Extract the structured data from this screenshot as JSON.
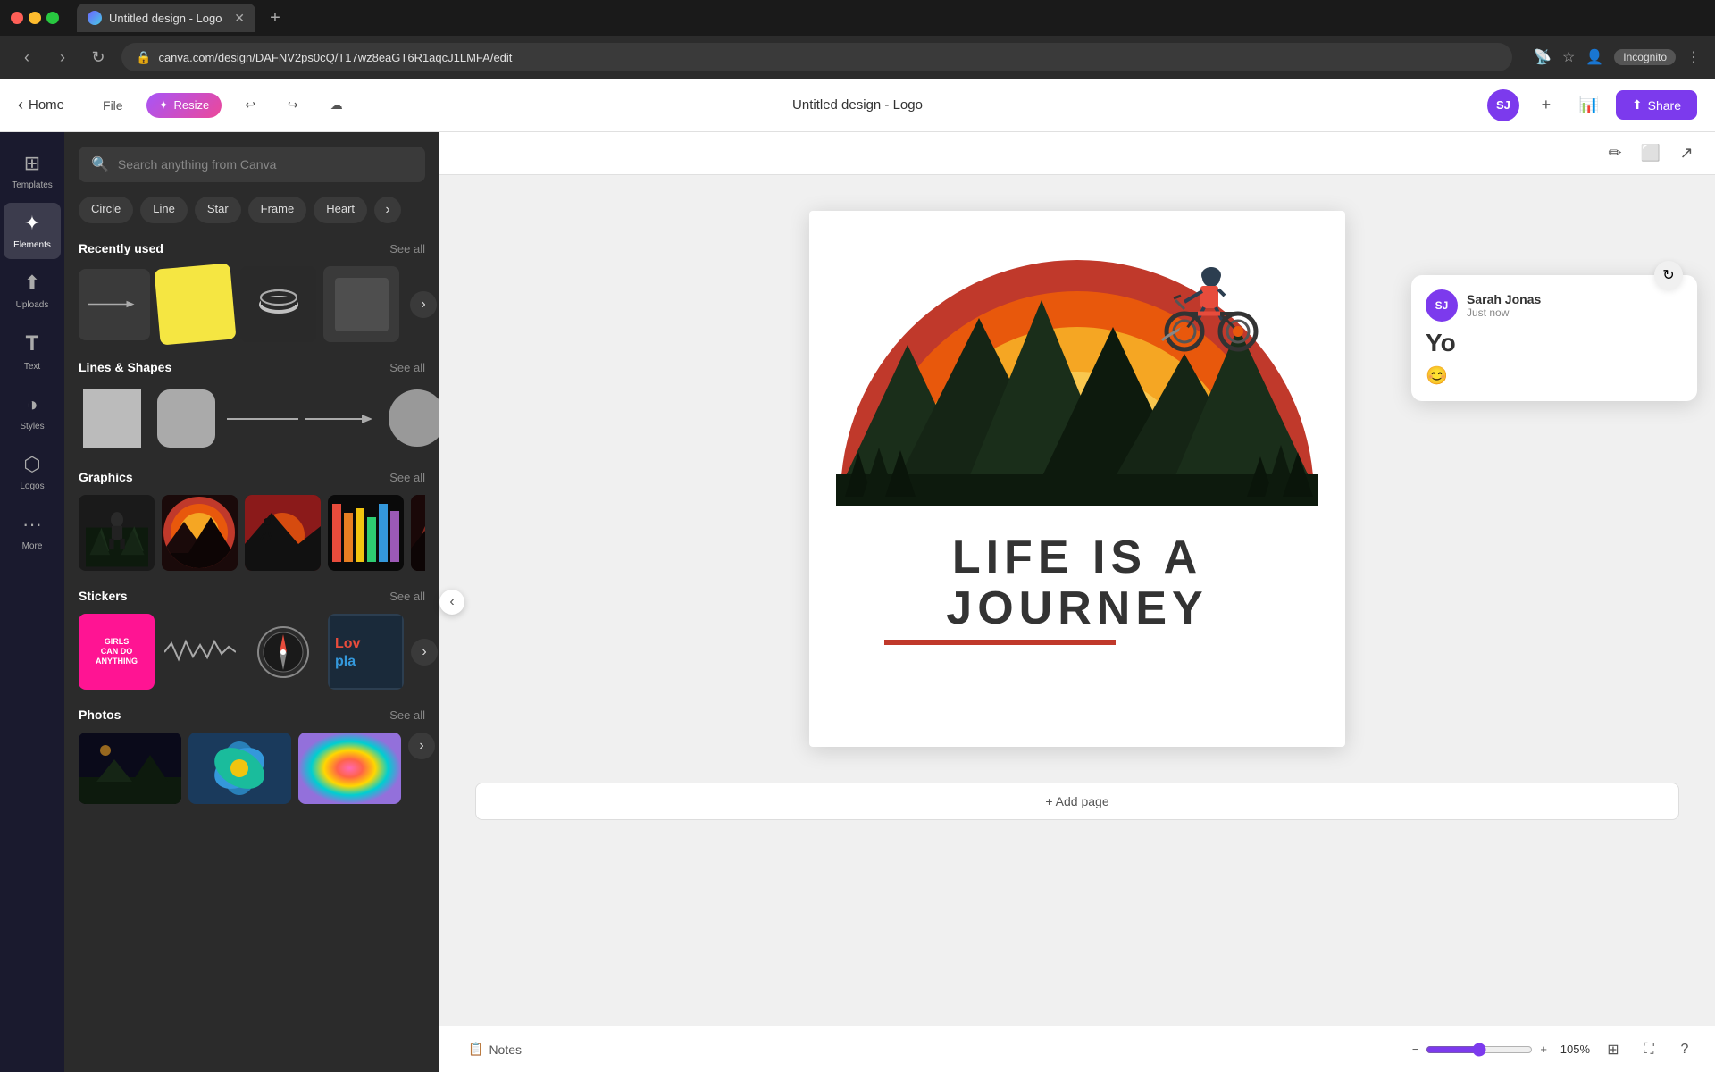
{
  "browser": {
    "tab_title": "Untitled design - Logo",
    "url": "canva.com/design/DAFNV2ps0cQ/T17wz8eaGT6R1aqcJ1LMFA/edit",
    "incognito_label": "Incognito"
  },
  "toolbar": {
    "home_label": "Home",
    "file_label": "File",
    "resize_label": "Resize",
    "undo_icon": "↩",
    "redo_icon": "↪",
    "save_icon": "☁",
    "title": "Untitled design - Logo",
    "user_initials": "SJ",
    "share_label": "Share",
    "plus_icon": "+",
    "chart_icon": "📊"
  },
  "sidebar": {
    "items": [
      {
        "id": "templates",
        "label": "Templates",
        "icon": "⊞"
      },
      {
        "id": "elements",
        "label": "Elements",
        "icon": "✦"
      },
      {
        "id": "uploads",
        "label": "Uploads",
        "icon": "⬆"
      },
      {
        "id": "text",
        "label": "Text",
        "icon": "T"
      },
      {
        "id": "styles",
        "label": "Styles",
        "icon": "◑"
      },
      {
        "id": "logos",
        "label": "Logos",
        "icon": "⬡"
      },
      {
        "id": "more",
        "label": "More",
        "icon": "···"
      }
    ]
  },
  "elements_panel": {
    "search_placeholder": "Search anything from Canva",
    "filter_chips": [
      "Circle",
      "Line",
      "Star",
      "Frame",
      "Heart"
    ],
    "recently_used": {
      "title": "Recently used",
      "see_all": "See all"
    },
    "lines_shapes": {
      "title": "Lines & Shapes",
      "see_all": "See all"
    },
    "graphics": {
      "title": "Graphics",
      "see_all": "See all"
    },
    "stickers": {
      "title": "Stickers",
      "see_all": "See all"
    },
    "photos": {
      "title": "Photos",
      "see_all": "See all"
    }
  },
  "canvas": {
    "design_title": "Untitled design - Logo",
    "journey_text": "LIFE IS A JOURNEY",
    "add_page_label": "+ Add page",
    "canvas_tools": [
      "edit",
      "frame",
      "export"
    ]
  },
  "comment": {
    "user": "Sarah Jonas",
    "initials": "SJ",
    "time": "Just now",
    "text": "Yo",
    "react_icon": "😊"
  },
  "bottom_bar": {
    "notes_icon": "📋",
    "notes_label": "Notes",
    "zoom_value": "105%",
    "collapse_icon": "⌃",
    "fullscreen_icon": "⛶",
    "help_icon": "?"
  },
  "colors": {
    "accent": "#7c3aed",
    "sunset_orange": "#e8580c",
    "sunset_red": "#c0392b",
    "sunset_yellow": "#f5a623",
    "mountain_dark": "#1a2e1a",
    "sky_red": "#c0392b",
    "sky_orange": "#e8580c"
  }
}
